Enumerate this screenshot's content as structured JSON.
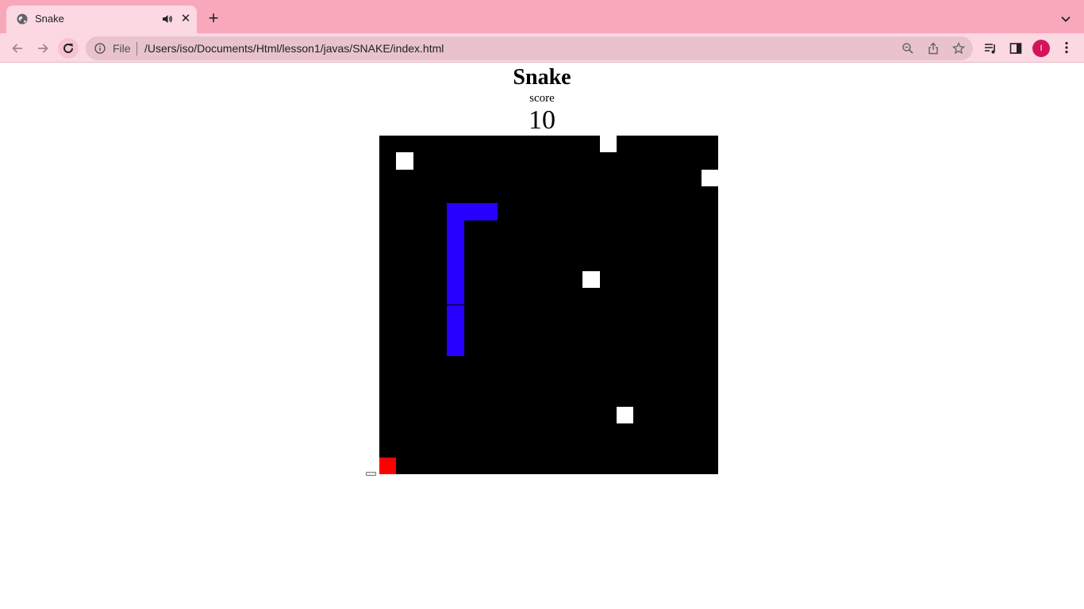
{
  "browser": {
    "tab": {
      "title": "Snake",
      "favicon": "globe-icon",
      "audio_icon": "speaker-icon",
      "close_label": "✕"
    },
    "new_tab_label": "+",
    "address": {
      "scheme_label": "File",
      "url": "/Users/iso/Documents/Html/lesson1/javas/SNAKE/index.html"
    },
    "profile_initial": "I",
    "colors": {
      "tabbar": "#f9a8bc",
      "toolbar": "#fcd8e2",
      "omnibox": "#e8c3cc",
      "avatar": "#d3145a"
    }
  },
  "game": {
    "title": "Snake",
    "score_label": "score",
    "score": "10",
    "grid": {
      "columns": 20,
      "rows": 20
    },
    "colors": {
      "board": "#000000",
      "snake": "#2600ff",
      "food": "#ffffff",
      "special": "#ff0000"
    },
    "snake": [
      [
        6,
        4
      ],
      [
        5,
        4
      ],
      [
        4,
        4
      ],
      [
        4,
        5
      ],
      [
        4,
        6
      ],
      [
        4,
        7
      ],
      [
        4,
        8
      ],
      [
        4,
        9
      ],
      [
        4,
        10
      ],
      [
        4,
        11
      ],
      [
        4,
        12
      ]
    ],
    "food": [
      [
        1,
        1
      ],
      [
        13,
        0
      ],
      [
        19,
        2
      ],
      [
        12,
        8
      ],
      [
        14,
        16
      ]
    ],
    "special": [
      [
        0,
        19
      ]
    ]
  }
}
